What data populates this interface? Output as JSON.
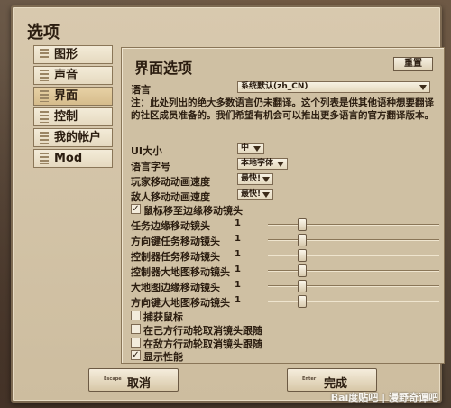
{
  "dialog": {
    "title": "选项"
  },
  "tabs": [
    {
      "label": "图形"
    },
    {
      "label": "声音"
    },
    {
      "label": "界面"
    },
    {
      "label": "控制"
    },
    {
      "label": "我的帐户"
    },
    {
      "label": "Mod"
    }
  ],
  "active_tab": "界面",
  "panel": {
    "title": "界面选项",
    "reset_label": "重置",
    "language": {
      "label": "语言",
      "value": "系统默认(zh_CN)"
    },
    "note": "注：此处列出的绝大多数语言仍未翻译。这个列表是供其他语种想要翻译的社区成员准备的。我们希望有机会可以推出更多语言的官方翻译版本。",
    "dropdowns": [
      {
        "label": "UI大小",
        "value": "中"
      },
      {
        "label": "语言字号",
        "value": "本地字体"
      },
      {
        "label": "玩家移动动画速度",
        "value": "最快!"
      },
      {
        "label": "敌人移动动画速度",
        "value": "最快!"
      }
    ],
    "edge_pan": {
      "label": "鼠标移至边缘移动镜头",
      "checked": true,
      "mark": "✓"
    },
    "sliders": [
      {
        "label": "任务边缘移动镜头",
        "value": "1",
        "level": 0.2
      },
      {
        "label": "方向键任务移动镜头",
        "value": "1",
        "level": 0.2
      },
      {
        "label": "控制器任务移动镜头",
        "value": "1",
        "level": 0.2
      },
      {
        "label": "控制器大地图移动镜头",
        "value": "1",
        "level": 0.2
      },
      {
        "label": "大地图边缘移动镜头",
        "value": "1",
        "level": 0.2
      },
      {
        "label": "方向键大地图移动镜头",
        "value": "1",
        "level": 0.2
      }
    ],
    "checkboxes": [
      {
        "label": "捕获鼠标",
        "checked": false,
        "mark": ""
      },
      {
        "label": "在己方行动轮取消镜头跟随",
        "checked": false,
        "mark": ""
      },
      {
        "label": "在敌方行动轮取消镜头跟随",
        "checked": false,
        "mark": ""
      },
      {
        "label": "显示性能",
        "checked": true,
        "mark": "✓"
      }
    ]
  },
  "footer": {
    "cancel": {
      "key": "Escape",
      "label": "取消"
    },
    "done": {
      "key": "Enter",
      "label": "完成"
    }
  },
  "watermark": "Bai度贴吧 | 漫野奇谭吧",
  "colors": {
    "panel": "#cfc0a3",
    "text": "#2b1d10",
    "border": "#7d6a52"
  }
}
